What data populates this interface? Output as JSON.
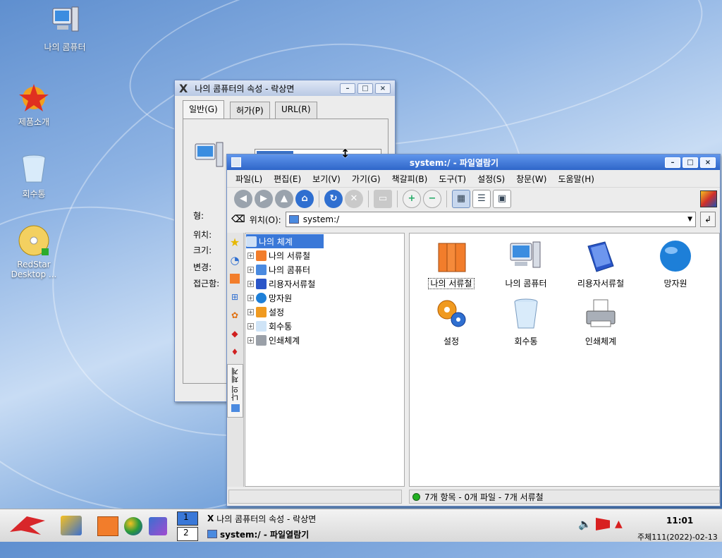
{
  "desktop": {
    "icons": [
      {
        "label": "나의 콤퓨터",
        "icon": "computer-icon"
      },
      {
        "label": "제품소개",
        "icon": "redstar-icon"
      },
      {
        "label": "회수통",
        "icon": "trash-icon"
      },
      {
        "label": "RedStar Desktop ...",
        "icon": "cd-icon"
      }
    ]
  },
  "props_window": {
    "title": "나의 콤퓨터의 속성 - 락상면",
    "tabs": [
      "일반(G)",
      "허가(P)",
      "URL(R)"
    ],
    "labels": [
      "형:",
      "위치:",
      "크기:",
      "변경:",
      "접근함:"
    ]
  },
  "fm_window": {
    "title": "system:/ - 파일열람기",
    "menu": [
      "파일(L)",
      "편집(E)",
      "보기(V)",
      "가기(G)",
      "책갈피(B)",
      "도구(T)",
      "설정(S)",
      "창문(W)",
      "도움말(H)"
    ],
    "location_label": "위치(O):",
    "location_value": "system:/",
    "tree_root": "나의 체계",
    "tree": [
      "나의 서류철",
      "나의 콤퓨터",
      "리용자서류철",
      "망자원",
      "설정",
      "회수통",
      "인쇄체계"
    ],
    "side_tab_label": "나의 체계",
    "items": [
      {
        "label": "나의 서류철",
        "icon": "folder-icon"
      },
      {
        "label": "나의 콤퓨터",
        "icon": "computer-icon"
      },
      {
        "label": "리용자서류철",
        "icon": "book-icon"
      },
      {
        "label": "망자원",
        "icon": "globe-icon"
      },
      {
        "label": "설정",
        "icon": "gears-icon"
      },
      {
        "label": "회수통",
        "icon": "trash-icon"
      },
      {
        "label": "인쇄체계",
        "icon": "printer-icon"
      }
    ],
    "status": "7개 항목 - 0개 파일 - 7개 서류철"
  },
  "taskbar": {
    "pager": [
      "1",
      "2"
    ],
    "tasks": [
      "나의 콤퓨터의 속성 - 락상면",
      "system:/ - 파일열람기"
    ],
    "clock": "11:01",
    "date": "주체111(2022)-02-13"
  }
}
